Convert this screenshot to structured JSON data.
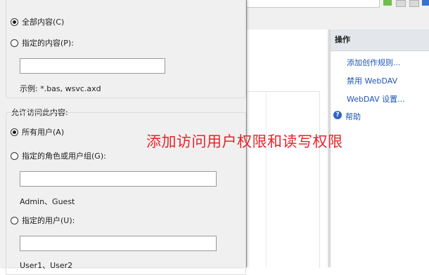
{
  "dialog": {
    "content_all_label": "全部内容(C)",
    "content_specified_label": "指定的内容(P):",
    "content_example": "示例: *.bas, wsvc.axd",
    "allow_access_label": "允许访问此内容:",
    "all_users_label": "所有用户(A)",
    "roles_groups_label": "指定的角色或用户组(G):",
    "roles_hint": "Admin、Guest",
    "specified_users_label": "指定的用户(U):",
    "users_hint": "User1、User2"
  },
  "actions_panel": {
    "header": "操作",
    "items": [
      {
        "label": "添加创作规则..."
      },
      {
        "label": "禁用 WebDAV"
      },
      {
        "label": "WebDAV 设置..."
      }
    ],
    "help_label": "帮助",
    "link_color": "#1f55b5"
  },
  "annotation": {
    "text": "添加访问用户权限和读写权限",
    "color": "#e8232a"
  }
}
